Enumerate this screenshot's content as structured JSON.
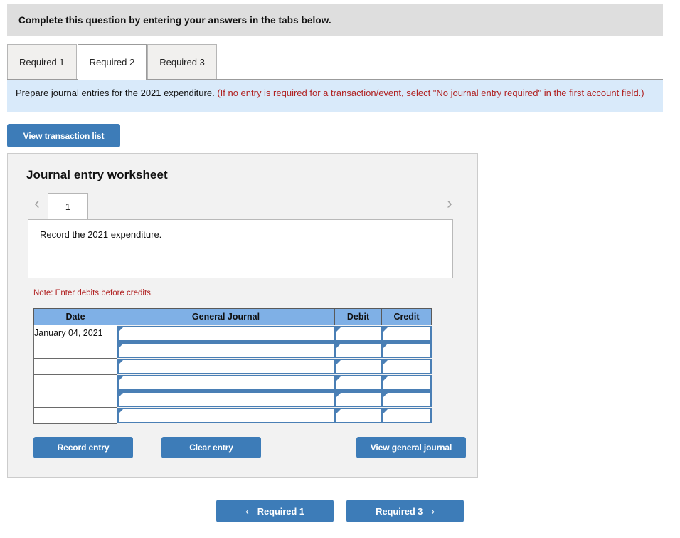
{
  "banner": {
    "text": "Complete this question by entering your answers in the tabs below."
  },
  "tabs": [
    {
      "label": "Required 1",
      "active": false
    },
    {
      "label": "Required 2",
      "active": true
    },
    {
      "label": "Required 3",
      "active": false
    }
  ],
  "requirement_note": {
    "black_text": "Prepare journal entries for the 2021 expenditure.",
    "red_text": "(If no entry is required for a transaction/event, select \"No journal entry required\" in the first account field.)"
  },
  "toolbar": {
    "view_transaction_list_label": "View transaction list"
  },
  "worksheet": {
    "title": "Journal entry worksheet",
    "pager": {
      "prev_icon": "‹",
      "next_icon": "›",
      "entries": [
        "1"
      ],
      "selected": "1"
    },
    "prompt": "Record the 2021 expenditure.",
    "note": "Note: Enter debits before credits.",
    "table": {
      "columns": [
        "Date",
        "General Journal",
        "Debit",
        "Credit"
      ],
      "rows": [
        {
          "date": "January 04, 2021",
          "general_journal": "",
          "debit": "",
          "credit": ""
        },
        {
          "date": "",
          "general_journal": "",
          "debit": "",
          "credit": ""
        },
        {
          "date": "",
          "general_journal": "",
          "debit": "",
          "credit": ""
        },
        {
          "date": "",
          "general_journal": "",
          "debit": "",
          "credit": ""
        },
        {
          "date": "",
          "general_journal": "",
          "debit": "",
          "credit": ""
        },
        {
          "date": "",
          "general_journal": "",
          "debit": "",
          "credit": ""
        }
      ]
    },
    "buttons": {
      "record_entry_label": "Record entry",
      "clear_entry_label": "Clear entry",
      "view_general_journal_label": "View general journal"
    }
  },
  "bottom_nav": {
    "prev_chevron": "‹",
    "prev_label": "Required 1",
    "next_label": "Required 3",
    "next_chevron": "›"
  },
  "colors": {
    "accent_blue": "#3d7cb8",
    "banner_gray": "#dedede",
    "note_blue": "#d9eafa",
    "note_red": "#b02222",
    "table_header_blue": "#7fb0e6",
    "input_border_blue": "#4a7fb5"
  }
}
